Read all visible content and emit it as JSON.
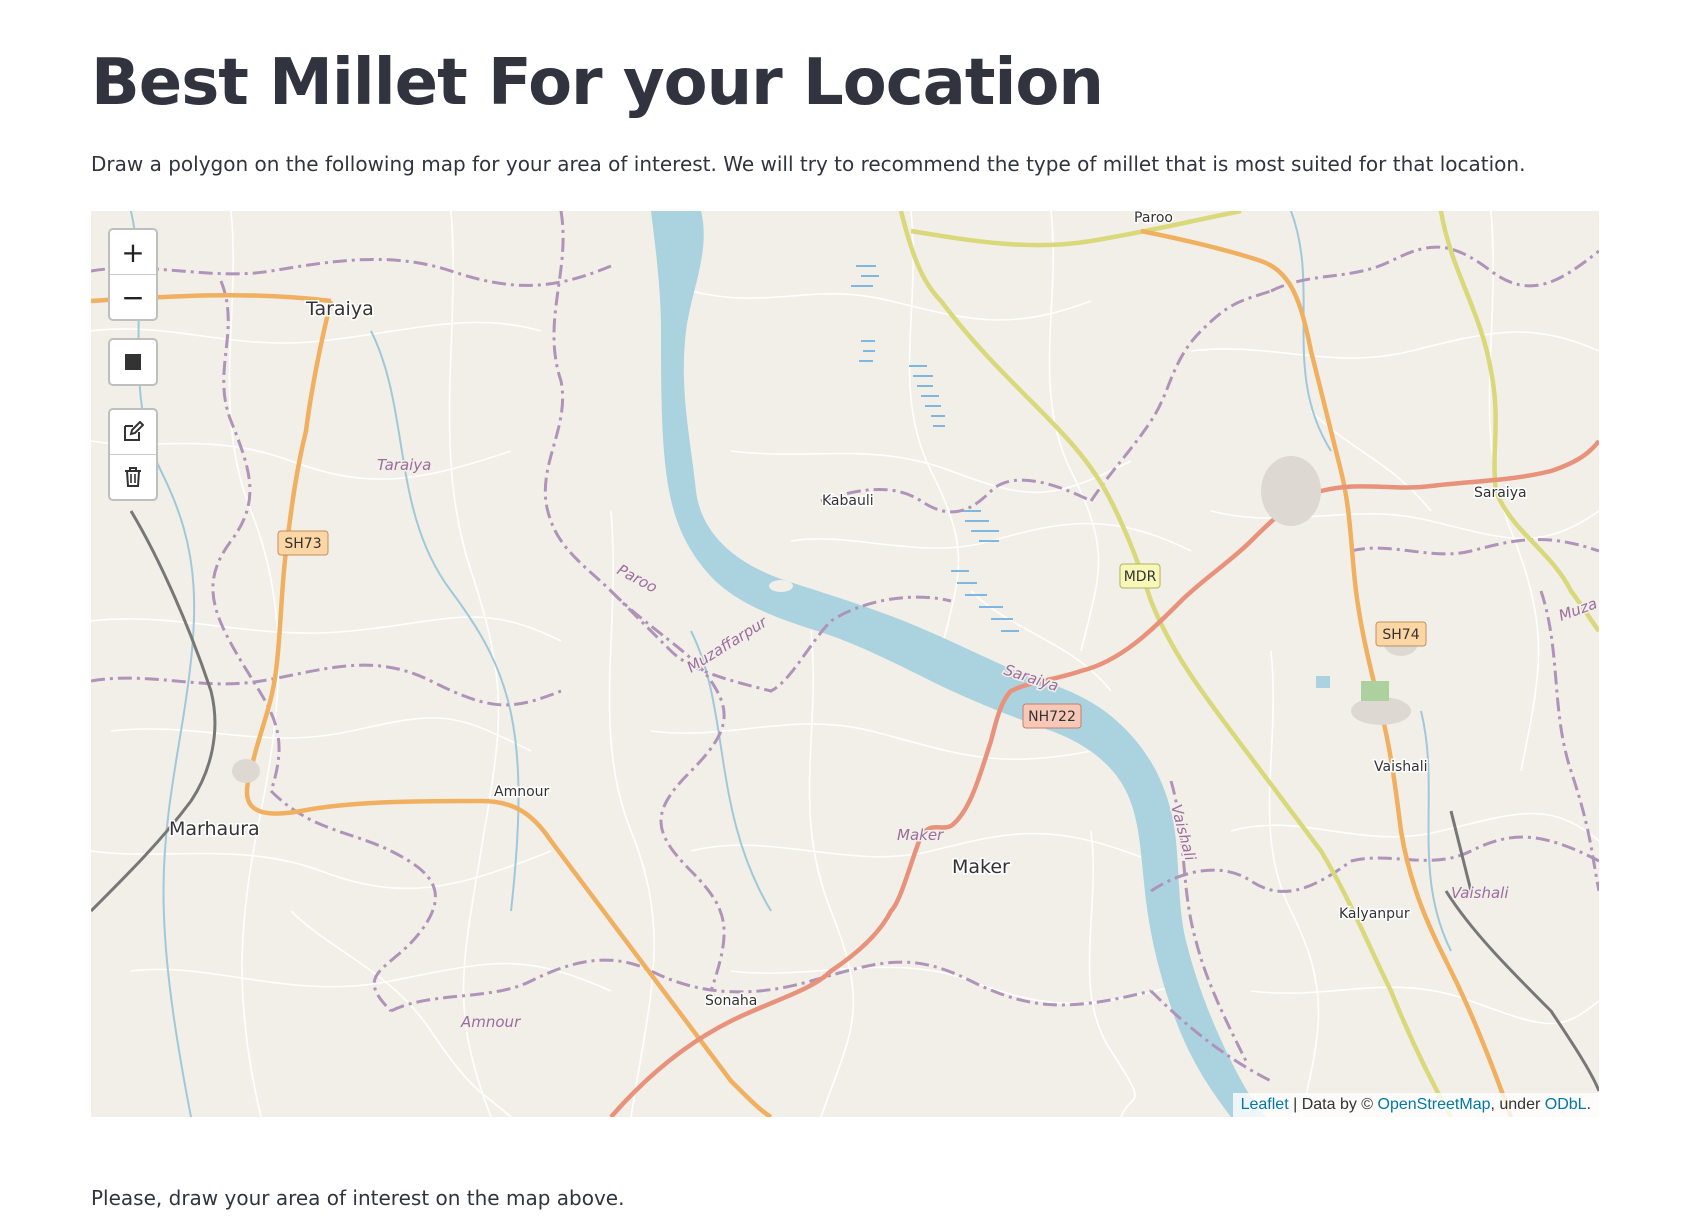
{
  "page": {
    "title": "Best Millet For your Location",
    "intro": "Draw a polygon on the following map for your area of interest. We will try to recommend the type of millet that is most suited for that location.",
    "note": "Please, draw your area of interest on the map above."
  },
  "map": {
    "controls": {
      "zoom_in": "+",
      "zoom_out": "−"
    },
    "attribution": {
      "leaflet": "Leaflet",
      "sep": " | Data by © ",
      "osm": "OpenStreetMap",
      "under": ", under ",
      "odbl": "ODbL",
      "end": "."
    },
    "places": {
      "paroo": "Paroo",
      "taraiya": "Taraiya",
      "kabauli": "Kabauli",
      "saraiya": "Saraiya",
      "marhaura": "Marhaura",
      "amnour": "Amnour",
      "maker": "Maker",
      "vaishali": "Vaishali",
      "kalyanpur": "Kalyanpur",
      "sonaha": "Sonaha"
    },
    "admin_labels": {
      "taraiya": "Taraiya",
      "paroo": "Paroo",
      "muzaffarpur": "Muzaffarpur",
      "saraiya": "Saraiya",
      "maker": "Maker",
      "vaishali_river": "Vaishali",
      "vaishali": "Vaishali",
      "amnour": "Amnour",
      "muza": "Muza"
    },
    "shields": {
      "sh73": "SH73",
      "mdr": "MDR",
      "sh74": "SH74",
      "nh722": "NH722"
    },
    "colors": {
      "land": "#f2efe9",
      "water": "#aad3df",
      "trunk": "#e8927c",
      "state": "#f7bc70",
      "secondary": "#f2f28a",
      "admin": "#b093b8"
    }
  }
}
